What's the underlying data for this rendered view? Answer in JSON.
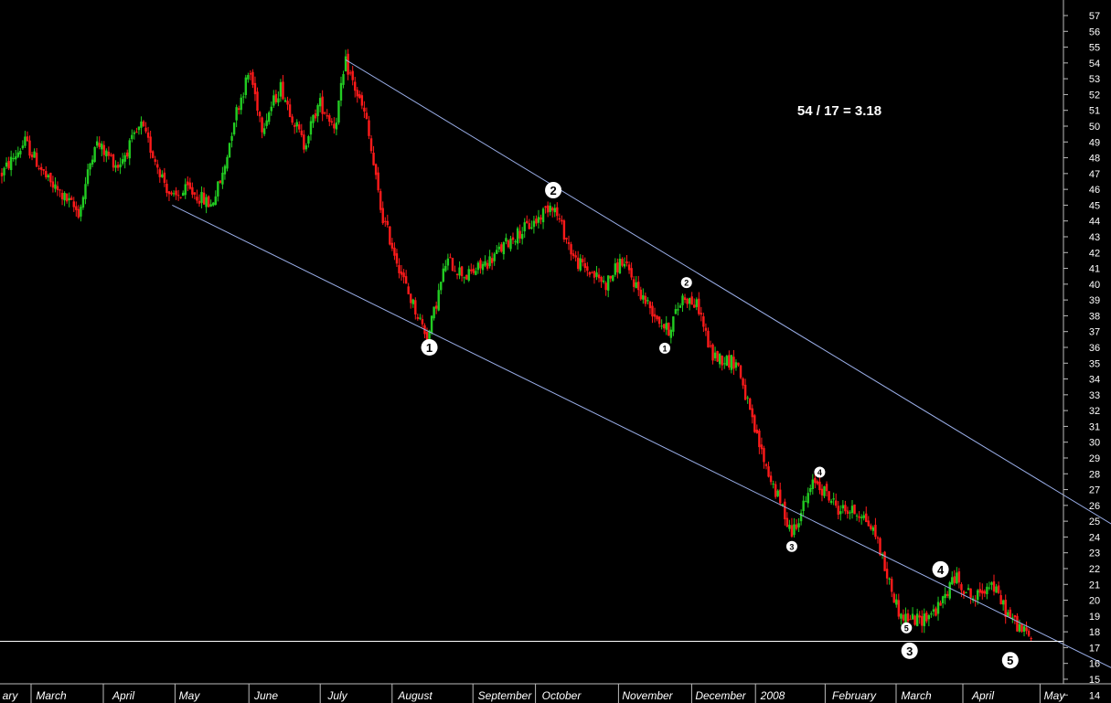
{
  "chart_data": {
    "type": "candlestick",
    "ylim": [
      13.5,
      58
    ],
    "y_ticks": [
      14,
      15,
      16,
      17,
      18,
      19,
      20,
      21,
      22,
      23,
      24,
      25,
      26,
      27,
      28,
      29,
      30,
      31,
      32,
      33,
      34,
      35,
      36,
      37,
      38,
      39,
      40,
      41,
      42,
      43,
      44,
      45,
      46,
      47,
      48,
      49,
      50,
      51,
      52,
      53,
      54,
      55,
      56,
      57
    ],
    "x_labels": [
      "ary",
      "March",
      "April",
      "May",
      "June",
      "July",
      "August",
      "September",
      "October",
      "November",
      "December",
      "2008",
      "February",
      "March",
      "April",
      "May"
    ],
    "annotation": "54 / 17 = 3.18",
    "horizontal_level": 17.4,
    "colors": {
      "up": "#22cc22",
      "down": "#ff1a1a",
      "channel": "#9aaee8",
      "level": "#ffffff",
      "text": "#ffffff",
      "background": "#000000"
    },
    "channel_lines": [
      {
        "from": {
          "day": 222,
          "price": 54.2
        },
        "to": {
          "day": 752,
          "price": 22.7
        }
      },
      {
        "from": {
          "day": 110,
          "price": 45.0
        },
        "to": {
          "day": 752,
          "price": 14.0
        }
      }
    ],
    "anchors": [
      {
        "day": 0,
        "price": 47
      },
      {
        "day": 15,
        "price": 49
      },
      {
        "day": 30,
        "price": 46.5
      },
      {
        "day": 50,
        "price": 44.5
      },
      {
        "day": 60,
        "price": 49
      },
      {
        "day": 75,
        "price": 47.5
      },
      {
        "day": 90,
        "price": 50
      },
      {
        "day": 110,
        "price": 45.3
      },
      {
        "day": 120,
        "price": 46
      },
      {
        "day": 135,
        "price": 45
      },
      {
        "day": 143,
        "price": 47
      },
      {
        "day": 150,
        "price": 50.5
      },
      {
        "day": 160,
        "price": 53.5
      },
      {
        "day": 168,
        "price": 50
      },
      {
        "day": 180,
        "price": 52.5
      },
      {
        "day": 195,
        "price": 48.8
      },
      {
        "day": 205,
        "price": 51.5
      },
      {
        "day": 215,
        "price": 50
      },
      {
        "day": 222,
        "price": 54
      },
      {
        "day": 235,
        "price": 50.5
      },
      {
        "day": 245,
        "price": 44.5
      },
      {
        "day": 262,
        "price": 39.5
      },
      {
        "day": 275,
        "price": 36.6
      },
      {
        "day": 287,
        "price": 41.5
      },
      {
        "day": 300,
        "price": 40.5
      },
      {
        "day": 315,
        "price": 41.5
      },
      {
        "day": 330,
        "price": 43
      },
      {
        "day": 345,
        "price": 44
      },
      {
        "day": 355,
        "price": 45.2
      },
      {
        "day": 370,
        "price": 41.5
      },
      {
        "day": 390,
        "price": 40
      },
      {
        "day": 400,
        "price": 41.5
      },
      {
        "day": 415,
        "price": 39
      },
      {
        "day": 430,
        "price": 37
      },
      {
        "day": 440,
        "price": 39.3
      },
      {
        "day": 450,
        "price": 38.5
      },
      {
        "day": 458,
        "price": 35.5
      },
      {
        "day": 475,
        "price": 35
      },
      {
        "day": 485,
        "price": 31
      },
      {
        "day": 495,
        "price": 28
      },
      {
        "day": 510,
        "price": 24.3
      },
      {
        "day": 525,
        "price": 27.6
      },
      {
        "day": 540,
        "price": 25.8
      },
      {
        "day": 555,
        "price": 25.5
      },
      {
        "day": 565,
        "price": 24
      },
      {
        "day": 570,
        "price": 22
      },
      {
        "day": 580,
        "price": 19
      },
      {
        "day": 592,
        "price": 18.7
      },
      {
        "day": 605,
        "price": 19.5
      },
      {
        "day": 615,
        "price": 21.5
      },
      {
        "day": 628,
        "price": 20
      },
      {
        "day": 638,
        "price": 21.2
      },
      {
        "day": 650,
        "price": 19
      },
      {
        "day": 665,
        "price": 17.5
      }
    ],
    "wave_labels": [
      {
        "text": "1",
        "day": 276,
        "price": 36.0,
        "size": "large"
      },
      {
        "text": "2",
        "day": 356,
        "price": 45.95,
        "size": "large"
      },
      {
        "text": "1",
        "day": 428,
        "price": 35.95,
        "size": "small"
      },
      {
        "text": "2",
        "day": 442,
        "price": 40.1,
        "size": "small"
      },
      {
        "text": "3",
        "day": 510,
        "price": 23.4,
        "size": "small"
      },
      {
        "text": "4",
        "day": 528,
        "price": 28.1,
        "size": "small"
      },
      {
        "text": "5",
        "day": 584,
        "price": 18.25,
        "size": "small"
      },
      {
        "text": "3",
        "day": 586,
        "price": 16.8,
        "size": "large"
      },
      {
        "text": "4",
        "day": 606,
        "price": 21.95,
        "size": "large"
      },
      {
        "text": "5",
        "day": 651,
        "price": 16.2,
        "size": "large"
      }
    ]
  }
}
